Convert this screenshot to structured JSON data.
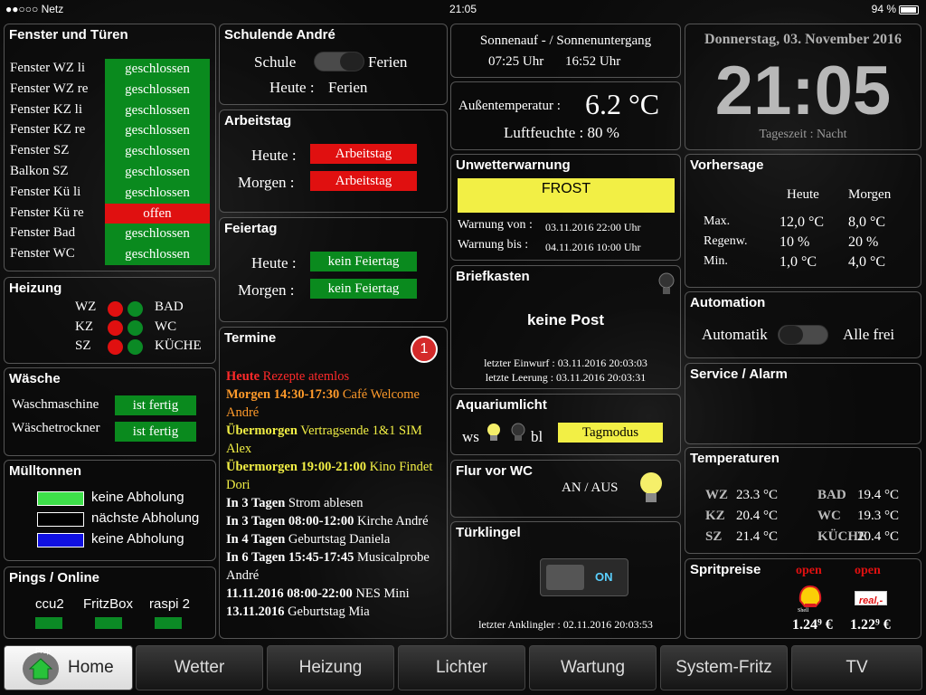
{
  "status": {
    "carrier": "●●○○○ Netz",
    "time": "21:05",
    "battery": "94 %"
  },
  "fenster": {
    "title": "Fenster und Türen",
    "rows": [
      {
        "label": "Fenster WZ li",
        "state": "geschlossen",
        "color": "green"
      },
      {
        "label": "Fenster WZ re",
        "state": "geschlossen",
        "color": "green"
      },
      {
        "label": "Fenster KZ li",
        "state": "geschlossen",
        "color": "green"
      },
      {
        "label": "Fenster KZ re",
        "state": "geschlossen",
        "color": "green"
      },
      {
        "label": "Fenster SZ",
        "state": "geschlossen",
        "color": "green"
      },
      {
        "label": "Balkon SZ",
        "state": "geschlossen",
        "color": "green"
      },
      {
        "label": "Fenster Kü li",
        "state": "geschlossen",
        "color": "green"
      },
      {
        "label": "Fenster Kü re",
        "state": "offen",
        "color": "red"
      },
      {
        "label": "Fenster Bad",
        "state": "geschlossen",
        "color": "green"
      },
      {
        "label": "Fenster WC",
        "state": "geschlossen",
        "color": "green"
      }
    ]
  },
  "heizung": {
    "title": "Heizung",
    "left": [
      "WZ",
      "KZ",
      "SZ"
    ],
    "right": [
      "BAD",
      "WC",
      "KÜCHE"
    ]
  },
  "waesche": {
    "title": "Wäsche",
    "rows": [
      {
        "label": "Waschmaschine",
        "state": "ist fertig"
      },
      {
        "label": "Wäschetrockner",
        "state": "ist fertig"
      }
    ]
  },
  "muell": {
    "title": "Mülltonnen",
    "rows": [
      {
        "label": "keine Abholung",
        "color": "#3ee04a"
      },
      {
        "label": "nächste Abholung",
        "color": "#000000"
      },
      {
        "label": "keine Abholung",
        "color": "#1010e0"
      }
    ]
  },
  "pings": {
    "title": "Pings / Online",
    "hosts": [
      "ccu2",
      "FritzBox",
      "raspi 2"
    ]
  },
  "schule": {
    "title": "Schulende André",
    "left": "Schule",
    "right": "Ferien",
    "heute_label": "Heute :",
    "heute_value": "Ferien"
  },
  "arbeitstag": {
    "title": "Arbeitstag",
    "heute_label": "Heute :",
    "heute": "Arbeitstag",
    "morgen_label": "Morgen :",
    "morgen": "Arbeitstag"
  },
  "feiertag": {
    "title": "Feiertag",
    "heute_label": "Heute :",
    "heute": "kein Feiertag",
    "morgen_label": "Morgen :",
    "morgen": "kein Feiertag"
  },
  "termine": {
    "title": "Termine",
    "badge": "1",
    "items": [
      {
        "when": "Heute",
        "text": " Rezepte atemlos",
        "color": "#ff2a2a"
      },
      {
        "when": "Morgen 14:30-17:30",
        "text": " Café Welcome André",
        "color": "#ff9a2a"
      },
      {
        "when": "Übermorgen",
        "text": " Vertragsende 1&1 SIM Alex",
        "color": "#f2ef45"
      },
      {
        "when": "Übermorgen 19:00-21:00",
        "text": " Kino Findet Dori",
        "color": "#f2ef45"
      },
      {
        "when": "In 3 Tagen",
        "text": " Strom ablesen",
        "color": "#ffffff"
      },
      {
        "when": "In 3 Tagen 08:00-12:00",
        "text": " Kirche André",
        "color": "#ffffff"
      },
      {
        "when": "In 4 Tagen",
        "text": " Geburtstag Daniela",
        "color": "#ffffff"
      },
      {
        "when": "In 6 Tagen 15:45-17:45",
        "text": " Musicalprobe André",
        "color": "#ffffff"
      },
      {
        "when": "11.11.2016 08:00-22:00",
        "text": " NES Mini",
        "color": "#ffffff"
      },
      {
        "when": "13.11.2016",
        "text": " Geburtstag Mia",
        "color": "#ffffff"
      }
    ]
  },
  "sonne": {
    "title": "Sonnenauf - / Sonnenuntergang",
    "auf": "07:25 Uhr",
    "unter": "16:52 Uhr"
  },
  "aussen": {
    "label": "Außentemperatur :",
    "temp": "6.2 °C",
    "humidity": "Luftfeuchte : 80 %"
  },
  "unwetter": {
    "title": "Unwetterwarnung",
    "warn": "FROST",
    "von_label": "Warnung von :",
    "von": "03.11.2016 22:00 Uhr",
    "bis_label": "Warnung bis :",
    "bis": "04.11.2016 10:00 Uhr"
  },
  "briefkasten": {
    "title": "Briefkasten",
    "status": "keine Post",
    "einwurf": "letzter Einwurf : 03.11.2016 20:03:03",
    "leerung": "letzte Leerung : 03.11.2016 20:03:31"
  },
  "aquarium": {
    "title": "Aquariumlicht",
    "ws": "ws",
    "bl": "bl",
    "mode": "Tagmodus"
  },
  "flur": {
    "title": "Flur vor WC",
    "label": "AN / AUS"
  },
  "klingel": {
    "title": "Türklingel",
    "toggle": "ON",
    "last": "letzter Anklingler : 02.11.2016 20:03:53"
  },
  "uhr": {
    "date": "Donnerstag, 03. November 2016",
    "time": "21:05",
    "tageszeit": "Tageszeit : Nacht"
  },
  "vorhersage": {
    "title": "Vorhersage",
    "col1": "Heute",
    "col2": "Morgen",
    "rows": [
      {
        "label": "Max.",
        "h": "12,0 °C",
        "m": "8,0 °C"
      },
      {
        "label": "Regenw.",
        "h": "10 %",
        "m": "20 %"
      },
      {
        "label": "Min.",
        "h": "1,0 °C",
        "m": "4,0 °C"
      }
    ]
  },
  "automation": {
    "title": "Automation",
    "label": "Automatik",
    "right": "Alle frei"
  },
  "service": {
    "title": "Service / Alarm"
  },
  "temps": {
    "title": "Temperaturen",
    "rows": [
      {
        "l": "WZ",
        "lv": "23.3 °C",
        "r": "BAD",
        "rv": "19.4 °C"
      },
      {
        "l": "KZ",
        "lv": "20.4 °C",
        "r": "WC",
        "rv": "19.3 °C"
      },
      {
        "l": "SZ",
        "lv": "21.4 °C",
        "r": "KÜCHE",
        "rv": "20.4 °C"
      }
    ]
  },
  "sprit": {
    "title": "Spritpreise",
    "s1_status": "open",
    "s1_brand": "Shell",
    "s1_price": "1.24⁹ €",
    "s2_status": "open",
    "s2_brand": "real,-",
    "s2_price": "1.22⁹ €"
  },
  "nav": {
    "items": [
      "Home",
      "Wetter",
      "Heizung",
      "Lichter",
      "Wartung",
      "System-Fritz",
      "TV"
    ],
    "home_badge": "Prop"
  }
}
